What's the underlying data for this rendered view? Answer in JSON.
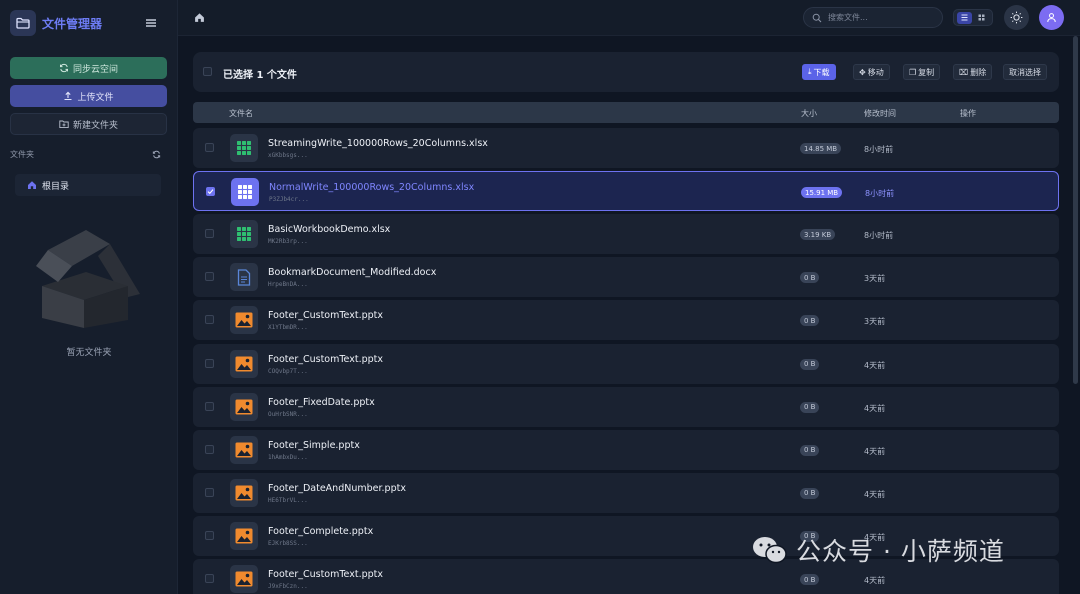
{
  "app": {
    "title": "文件管理器"
  },
  "sidebar": {
    "sync_label": "同步云空间",
    "upload_label": "上传文件",
    "new_folder_label": "新建文件夹",
    "folders_header": "文件夹",
    "root_label": "根目录",
    "empty_text": "暂无文件夹"
  },
  "topbar": {
    "search_placeholder": "搜索文件..."
  },
  "selection": {
    "text": "已选择 1 个文件",
    "actions": {
      "download": "下载",
      "move": "移动",
      "copy": "复制",
      "delete": "删除",
      "cancel": "取消选择"
    }
  },
  "table": {
    "columns": [
      "文件名",
      "大小",
      "修改时间",
      "操作"
    ],
    "rows": [
      {
        "name": "StreamingWrite_100000Rows_20Columns.xlsx",
        "id": "xGKbbsgs...",
        "size": "14.85 MB",
        "time": "8小时前",
        "type": "sheet",
        "selected": false
      },
      {
        "name": "NormalWrite_100000Rows_20Columns.xlsx",
        "id": "P3ZJb4cr...",
        "size": "15.91 MB",
        "time": "8小时前",
        "type": "sheet",
        "selected": true
      },
      {
        "name": "BasicWorkbookDemo.xlsx",
        "id": "MK2Rb3rp...",
        "size": "3.19 KB",
        "time": "8小时前",
        "type": "sheet",
        "selected": false
      },
      {
        "name": "BookmarkDocument_Modified.docx",
        "id": "HrpeBnDA...",
        "size": "0 B",
        "time": "3天前",
        "type": "doc",
        "selected": false
      },
      {
        "name": "Footer_CustomText.pptx",
        "id": "X1YTbmDR...",
        "size": "0 B",
        "time": "3天前",
        "type": "image",
        "selected": false
      },
      {
        "name": "Footer_CustomText.pptx",
        "id": "COQvbp7T...",
        "size": "0 B",
        "time": "4天前",
        "type": "image",
        "selected": false
      },
      {
        "name": "Footer_FixedDate.pptx",
        "id": "OuHrbSNR...",
        "size": "0 B",
        "time": "4天前",
        "type": "image",
        "selected": false
      },
      {
        "name": "Footer_Simple.pptx",
        "id": "1hAmbxDu...",
        "size": "0 B",
        "time": "4天前",
        "type": "image",
        "selected": false
      },
      {
        "name": "Footer_DateAndNumber.pptx",
        "id": "HE6TbrVL...",
        "size": "0 B",
        "time": "4天前",
        "type": "image",
        "selected": false
      },
      {
        "name": "Footer_Complete.pptx",
        "id": "EJKrb8SS...",
        "size": "0 B",
        "time": "4天前",
        "type": "image",
        "selected": false
      },
      {
        "name": "Footer_CustomText.pptx",
        "id": "J9xFbCzn...",
        "size": "0 B",
        "time": "4天前",
        "type": "image",
        "selected": false
      }
    ]
  },
  "watermark": {
    "text": "公众号 · 小萨频道"
  },
  "colors": {
    "accent": "#6d72f0",
    "sheet": "#2fbf71",
    "doc": "#5a86d8",
    "image": "#f08a2e",
    "sync": "#2c6e5a"
  }
}
